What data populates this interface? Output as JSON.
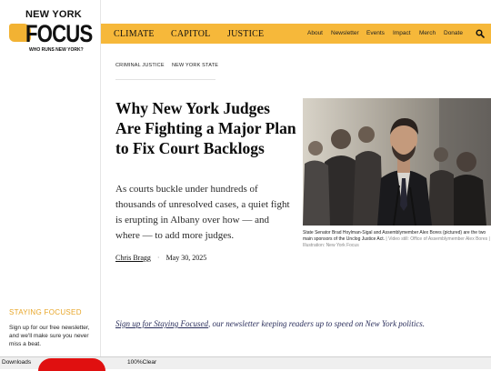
{
  "logo": {
    "line1": "NEW YORK",
    "line2": "FOCUS",
    "tagline": "WHO RUNS NEW YORK?"
  },
  "nav": {
    "sections": [
      "CLIMATE",
      "CAPITOL",
      "JUSTICE"
    ],
    "utility": [
      "About",
      "Newsletter",
      "Events",
      "Impact",
      "Merch",
      "Donate"
    ],
    "search_icon": "search-icon"
  },
  "colors": {
    "nav_bg": "#f6b83a",
    "accent": "#e8a628",
    "link": "#2b2f5c"
  },
  "article": {
    "breadcrumb": [
      "CRIMINAL JUSTICE",
      "NEW YORK STATE"
    ],
    "headline": "Why New York Judges Are Fighting a Major Plan to Fix Court Backlogs",
    "dek": "As courts buckle under hundreds of thousands of unresolved cases, a quiet fight is erupting in Albany over how — and where — to add more judges.",
    "author": "Chris Bragg",
    "date": "May 30, 2025",
    "caption": "State Senator Brad Hoylman-Sigal and Assemblymember Alex Bores (pictured) are the two main sponsors of the Unclog Justice Act.",
    "caption_credit": " | Video still: Office of Assemblymember Alex Bores | Illustration: New York Focus"
  },
  "newsletter": {
    "link_text": "Sign up for Staying Focused",
    "rest": ", our newsletter keeping readers up to speed on New York politics."
  },
  "sidebar": {
    "staying_focused_title": "STAYING FOCUSED",
    "staying_focused_text": "Sign up for our free newsletter, and we'll make sure you never miss a beat."
  },
  "bottombar": {
    "downloads": "Downloads",
    "zoom": "100%Clear"
  }
}
